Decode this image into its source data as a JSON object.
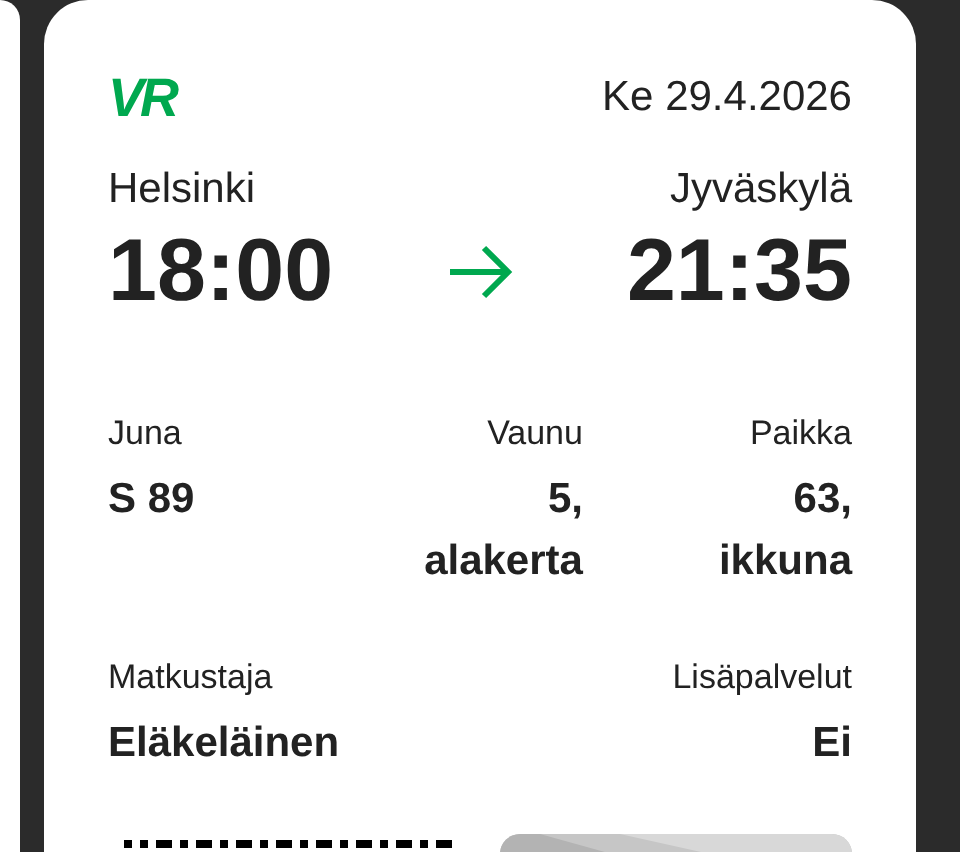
{
  "ticket": {
    "logo": "VR",
    "date": "Ke 29.4.2026",
    "departure": {
      "station": "Helsinki",
      "time": "18:00"
    },
    "arrival": {
      "station": "Jyväskylä",
      "time": "21:35"
    },
    "details": [
      {
        "label": "Juna",
        "value": "S 89"
      },
      {
        "label": "Vaunu",
        "value": "5,\nalakerta"
      },
      {
        "label": "Paikka",
        "value": "63,\nikkuna"
      }
    ],
    "extras": [
      {
        "label": "Matkustaja",
        "value": "Eläkeläinen"
      },
      {
        "label": "Lisäpalvelut",
        "value": "Ei"
      }
    ],
    "bottom": [
      {
        "kind": "barcode"
      },
      {
        "kind": "picture"
      }
    ]
  }
}
